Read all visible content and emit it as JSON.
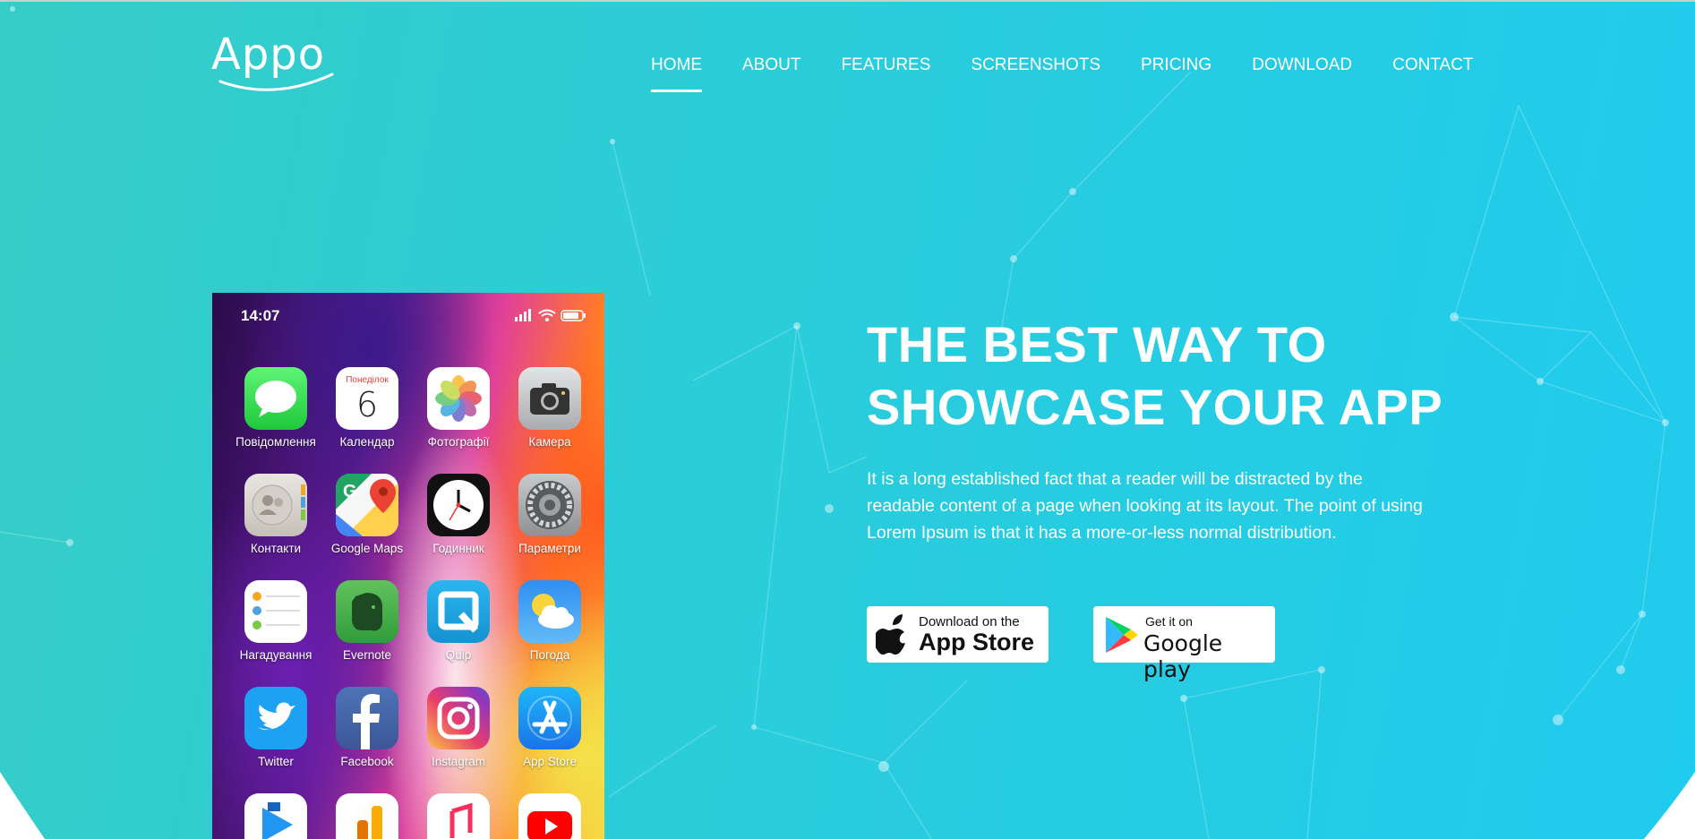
{
  "brand": {
    "logo_text": "Appo"
  },
  "nav": {
    "items": [
      {
        "label": "HOME",
        "active": true
      },
      {
        "label": "ABOUT"
      },
      {
        "label": "FEATURES"
      },
      {
        "label": "SCREENSHOTS"
      },
      {
        "label": "PRICING"
      },
      {
        "label": "DOWNLOAD"
      },
      {
        "label": "CONTACT"
      }
    ]
  },
  "hero": {
    "headline_line1": "THE BEST WAY TO",
    "headline_line2": "SHOWCASE YOUR APP",
    "description": "It is a long established fact that a reader will be distracted by the readable content of a page when looking at its layout. The point of using Lorem Ipsum is that it has a more-or-less normal distribution.",
    "app_store": {
      "small": "Download on the",
      "big": "App Store"
    },
    "google_play": {
      "small": "Get it on",
      "big": "Google play"
    }
  },
  "phone": {
    "time": "14:07",
    "calendar_day_name": "Понеділок",
    "calendar_day_number": "6",
    "apps": [
      {
        "label": "Повідомлення",
        "icon": "messages-icon"
      },
      {
        "label": "Календар",
        "icon": "calendar-icon"
      },
      {
        "label": "Фотографії",
        "icon": "photos-icon"
      },
      {
        "label": "Камера",
        "icon": "camera-icon"
      },
      {
        "label": "Контакти",
        "icon": "contacts-icon"
      },
      {
        "label": "Google Maps",
        "icon": "google-maps-icon"
      },
      {
        "label": "Годинник",
        "icon": "clock-icon"
      },
      {
        "label": "Параметри",
        "icon": "settings-icon"
      },
      {
        "label": "Нагадування",
        "icon": "reminders-icon"
      },
      {
        "label": "Evernote",
        "icon": "evernote-icon"
      },
      {
        "label": "Quip",
        "icon": "quip-icon"
      },
      {
        "label": "Погода",
        "icon": "weather-icon"
      },
      {
        "label": "Twitter",
        "icon": "twitter-icon"
      },
      {
        "label": "Facebook",
        "icon": "facebook-icon"
      },
      {
        "label": "Instagram",
        "icon": "instagram-icon"
      },
      {
        "label": "App Store",
        "icon": "app-store-icon"
      }
    ]
  },
  "colors": {
    "gradient_left": "#36cdc7",
    "gradient_right": "#1fcbee",
    "text": "#ffffff"
  }
}
